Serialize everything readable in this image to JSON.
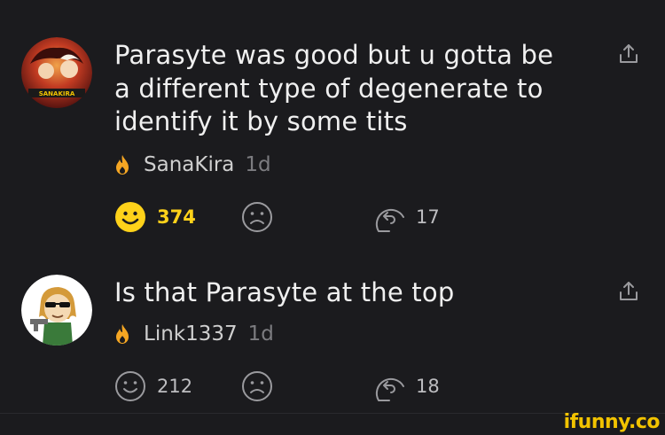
{
  "comments": [
    {
      "text_lines": [
        "Parasyte was good but u gotta be",
        "a different type of degenerate to",
        "identify it by some tits"
      ],
      "username": "SanaKira",
      "time": "1d",
      "smile_count": "374",
      "replies": "17",
      "avatar_label": "SANAKIRA"
    },
    {
      "text_lines": [
        "Is that Parasyte at the top"
      ],
      "username": "Link1337",
      "time": "1d",
      "smile_count": "212",
      "replies": "18"
    }
  ],
  "brand": "ifunny.co",
  "colors": {
    "accent": "#ffd21a",
    "flame": "#f5a623",
    "icon": "#9a9a9e"
  }
}
